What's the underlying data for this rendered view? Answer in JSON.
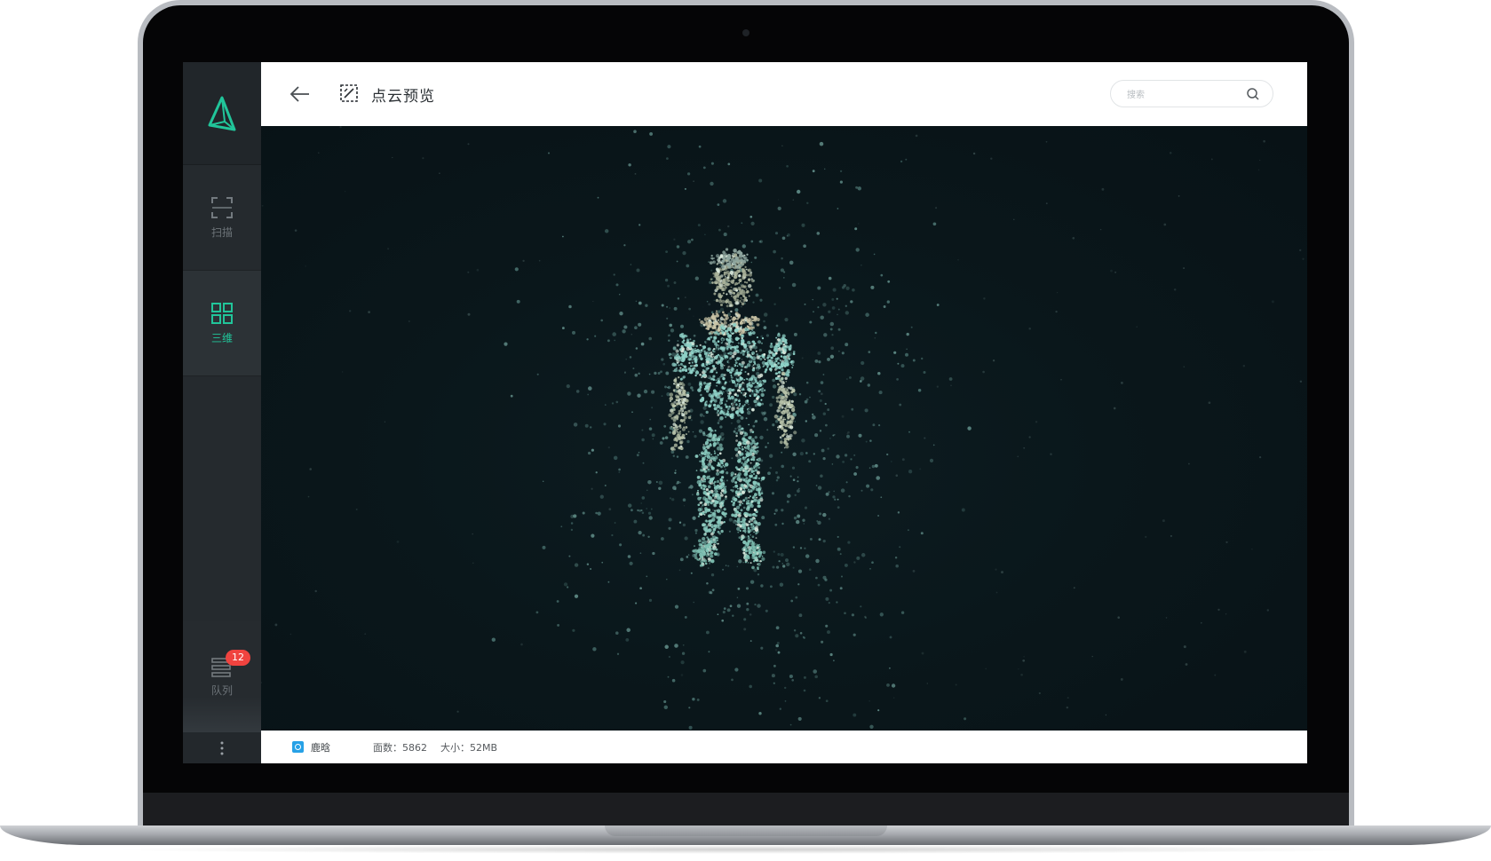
{
  "header": {
    "title": "点云预览",
    "search_placeholder": "搜索"
  },
  "sidebar": {
    "items": [
      {
        "label": "扫描",
        "icon": "scan-frame-icon",
        "active": false
      },
      {
        "label": "三维",
        "icon": "grid-icon",
        "active": true
      }
    ],
    "queue": {
      "label": "队列",
      "badge": "12",
      "icon": "stack-icon"
    },
    "more_icon": "vertical-dots-icon"
  },
  "viewport": {
    "content": "point-cloud-human-figure",
    "colors": {
      "background": "#0a1519",
      "points": "#8fd2c8"
    }
  },
  "footer": {
    "file_name": "鹿晗",
    "faces": "面数：5862",
    "size": "大小：52MB"
  },
  "colors": {
    "accent": "#21c59a",
    "badge": "#f0433f",
    "file_icon": "#27a1e6"
  }
}
